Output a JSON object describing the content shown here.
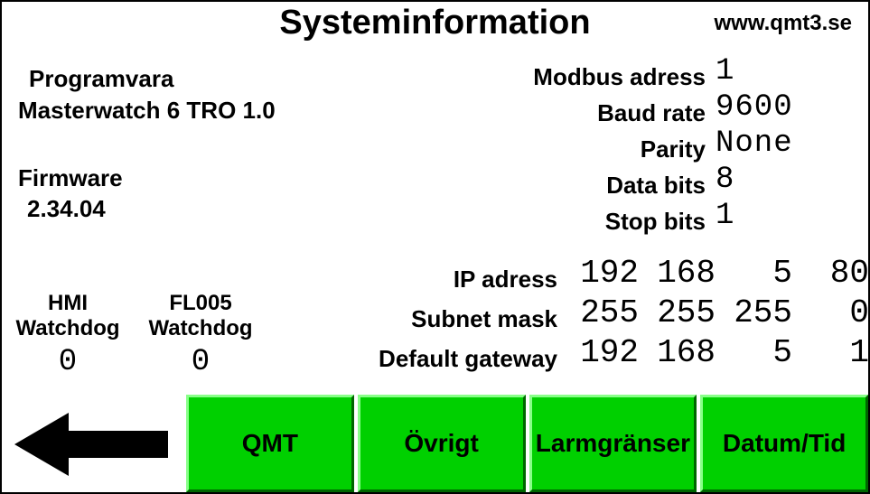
{
  "header": {
    "title": "Systeminformation",
    "url": "www.qmt3.se"
  },
  "software": {
    "label": "Programvara",
    "value": "Masterwatch 6 TRO 1.0"
  },
  "firmware": {
    "label": "Firmware",
    "value": "2.34.04"
  },
  "serial": {
    "modbus_label": "Modbus adress",
    "modbus_value": "1",
    "baud_label": "Baud rate",
    "baud_value": "9600",
    "parity_label": "Parity",
    "parity_value": "None",
    "databits_label": "Data bits",
    "databits_value": "8",
    "stopbits_label": "Stop bits",
    "stopbits_value": "1"
  },
  "network": {
    "ip_label": "IP adress",
    "ip": {
      "a": "192",
      "b": "168",
      "c": "5",
      "d": "80"
    },
    "subnet_label": "Subnet mask",
    "subnet": {
      "a": "255",
      "b": "255",
      "c": "255",
      "d": "0"
    },
    "gateway_label": "Default gateway",
    "gateway": {
      "a": "192",
      "b": "168",
      "c": "5",
      "d": "1"
    }
  },
  "watchdog": {
    "hmi_label_1": "HMI",
    "hmi_label_2": "Watchdog",
    "hmi_value": "0",
    "fl_label_1": "FL005",
    "fl_label_2": "Watchdog",
    "fl_value": "0"
  },
  "buttons": {
    "qmt": "QMT",
    "ovrigt": "Övrigt",
    "larm": "Larmgränser",
    "datum": "Datum/Tid"
  }
}
